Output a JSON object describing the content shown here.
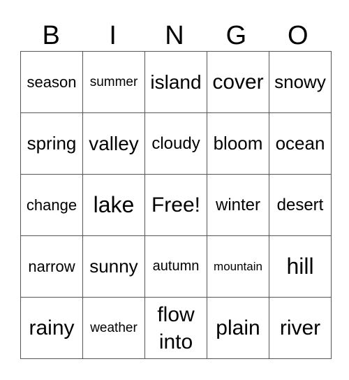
{
  "header": [
    "B",
    "I",
    "N",
    "G",
    "O"
  ],
  "rows": [
    [
      "season",
      "summer",
      "island",
      "cover",
      "snowy"
    ],
    [
      "spring",
      "valley",
      "cloudy",
      "bloom",
      "ocean"
    ],
    [
      "change",
      "lake",
      "Free!",
      "winter",
      "desert"
    ],
    [
      "narrow",
      "sunny",
      "autumn",
      "mountain",
      "hill"
    ],
    [
      "rainy",
      "weather",
      "flow into",
      "plain",
      "river"
    ]
  ]
}
